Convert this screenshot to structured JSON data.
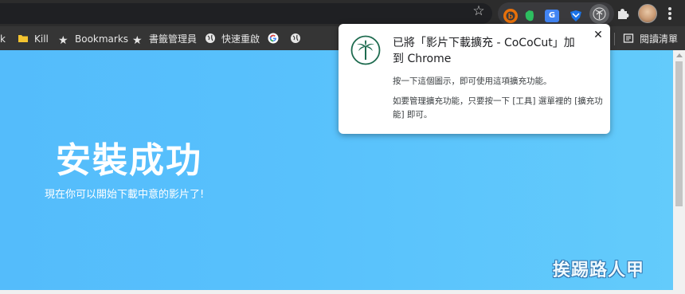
{
  "colors": {
    "toolbar": "#2c2c2c",
    "bookmarks_bar": "#353535",
    "page_bg": "#58c1fc",
    "popup_icon": "#1e6b4f"
  },
  "toolbar": {
    "bookmark_star_icon": "star-icon",
    "extensions": [
      "b-icon",
      "evernote-icon",
      "google-translate-icon",
      "shield-icon",
      "cococut-icon",
      "puzzle-icon"
    ],
    "translate_badge": "G"
  },
  "bookmarks": {
    "items": [
      {
        "label": "k",
        "icon": "none"
      },
      {
        "label": "Kill",
        "icon": "folder-icon"
      },
      {
        "label": "Bookmarks",
        "icon": "star-icon"
      },
      {
        "label": "書籤管理員",
        "icon": "star-icon"
      },
      {
        "label": "快速重啟",
        "icon": "globe-icon"
      },
      {
        "label": "",
        "icon": "google-icon"
      },
      {
        "label": "",
        "icon": "globe-icon"
      }
    ],
    "reading_list": "閱讀清單"
  },
  "page": {
    "title": "安裝成功",
    "subtitle": "現在你可以開始下載中意的影片了!"
  },
  "popup": {
    "title": "已將「影片下載擴充 - CoCoCut」加到 Chrome",
    "line1": "按一下這個圖示，即可使用這項擴充功能。",
    "line2": "如要管理擴充功能，只要按一下 [工具] 選單裡的 [擴充功能] 即可。",
    "close": "✕"
  },
  "watermark": "挨踢路人甲"
}
